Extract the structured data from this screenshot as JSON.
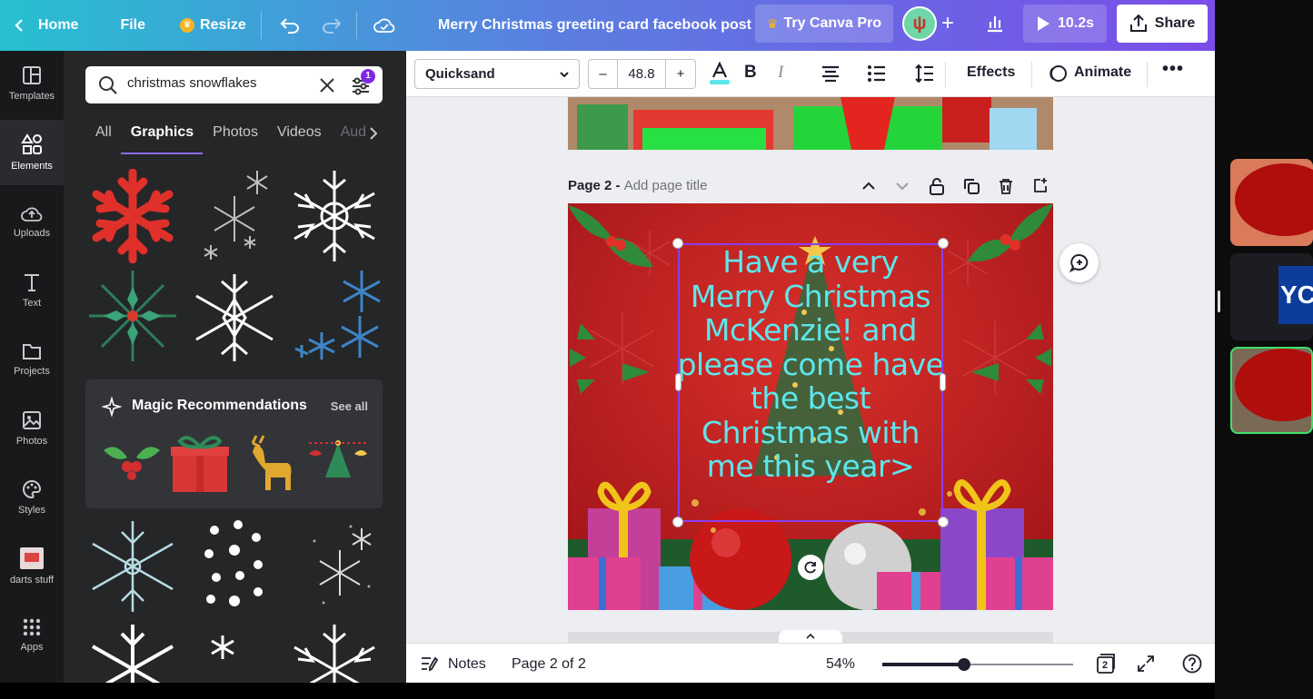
{
  "topbar": {
    "home": "Home",
    "file": "File",
    "resize": "Resize",
    "doc_title": "Merry Christmas greeting card facebook post",
    "try_pro": "Try Canva Pro",
    "play_time": "10.2s",
    "share": "Share",
    "colors": {
      "gradient_start": "#26c0d0",
      "gradient_end": "#7a4de8"
    }
  },
  "rail": [
    {
      "label": "Templates",
      "icon": "templates-icon"
    },
    {
      "label": "Elements",
      "icon": "elements-icon",
      "active": true
    },
    {
      "label": "Uploads",
      "icon": "uploads-icon"
    },
    {
      "label": "Text",
      "icon": "text-icon"
    },
    {
      "label": "Projects",
      "icon": "projects-icon"
    },
    {
      "label": "Photos",
      "icon": "photos-icon"
    },
    {
      "label": "Styles",
      "icon": "styles-icon"
    },
    {
      "label": "darts stuff",
      "icon": "folder-thumbnail"
    },
    {
      "label": "Apps",
      "icon": "apps-icon"
    }
  ],
  "panel": {
    "search_value": "christmas snowflakes",
    "filter_badge": "1",
    "tabs": [
      "All",
      "Graphics",
      "Photos",
      "Videos",
      "Aud"
    ],
    "active_tab": "Graphics",
    "magic_title": "Magic Recommendations",
    "see_all": "See all"
  },
  "toolbar": {
    "font": "Quicksand",
    "font_size": "48.8",
    "minus": "–",
    "plus": "+",
    "effects": "Effects",
    "animate": "Animate"
  },
  "page": {
    "label": "Page 2 -",
    "title_placeholder": "Add page title",
    "card_text": "Have a very Merry Christmas McKenzie! and please come have the best Christmas with me this year>"
  },
  "bottombar": {
    "notes": "Notes",
    "page_indicator": "Page 2 of 2",
    "zoom": "54%",
    "zoom_fraction": 0.43,
    "pages_count": "2"
  }
}
